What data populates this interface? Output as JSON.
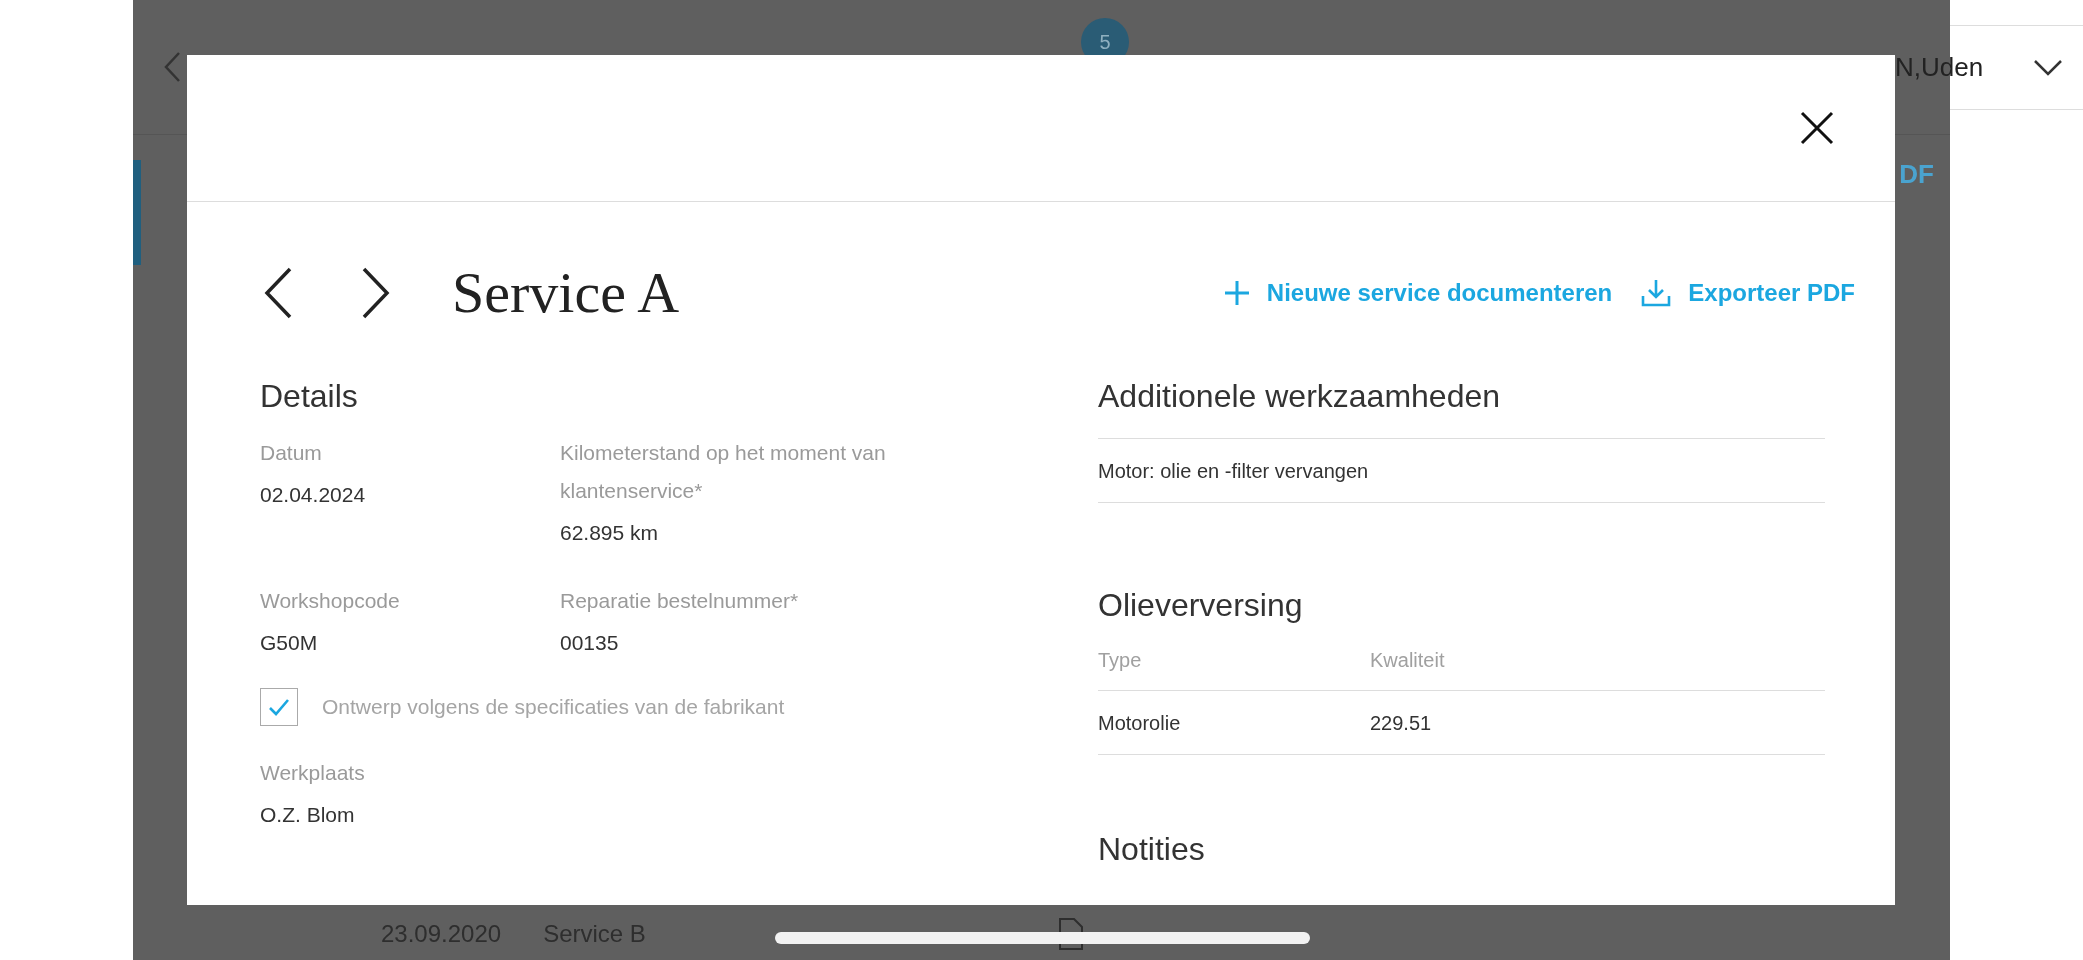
{
  "background_page": {
    "badge": "5",
    "location": "N,Uden",
    "export_link": "DF",
    "row": {
      "date": "23.09.2020",
      "service": "Service B"
    }
  },
  "modal": {
    "title": "Service A",
    "actions": [
      {
        "kind": "add",
        "label": "Nieuwe service documenteren"
      },
      {
        "kind": "download",
        "label": "Exporteer PDF"
      }
    ],
    "details": {
      "heading": "Details",
      "fields": [
        {
          "label": "Datum",
          "value": "02.04.2024"
        },
        {
          "label": "Kilometerstand op het moment van klantenservice*",
          "value": "62.895 km"
        },
        {
          "label": "Workshopcode",
          "value": "G50M"
        },
        {
          "label": "Reparatie bestelnummer*",
          "value": "00135"
        }
      ],
      "checkbox": {
        "label": "Ontwerp volgens de specificaties van de fabrikant",
        "checked": true
      },
      "workplace": {
        "label": "Werkplaats",
        "value": "O.Z. Blom"
      }
    },
    "additional_work": {
      "heading": "Additionele werkzaamheden",
      "items": [
        "Motor: olie en -filter vervangen"
      ]
    },
    "oil_change": {
      "heading": "Olieverversing",
      "columns": [
        "Type",
        "Kwaliteit"
      ],
      "rows": [
        [
          "Motorolie",
          "229.51"
        ]
      ]
    },
    "notes": {
      "heading": "Notities"
    }
  }
}
